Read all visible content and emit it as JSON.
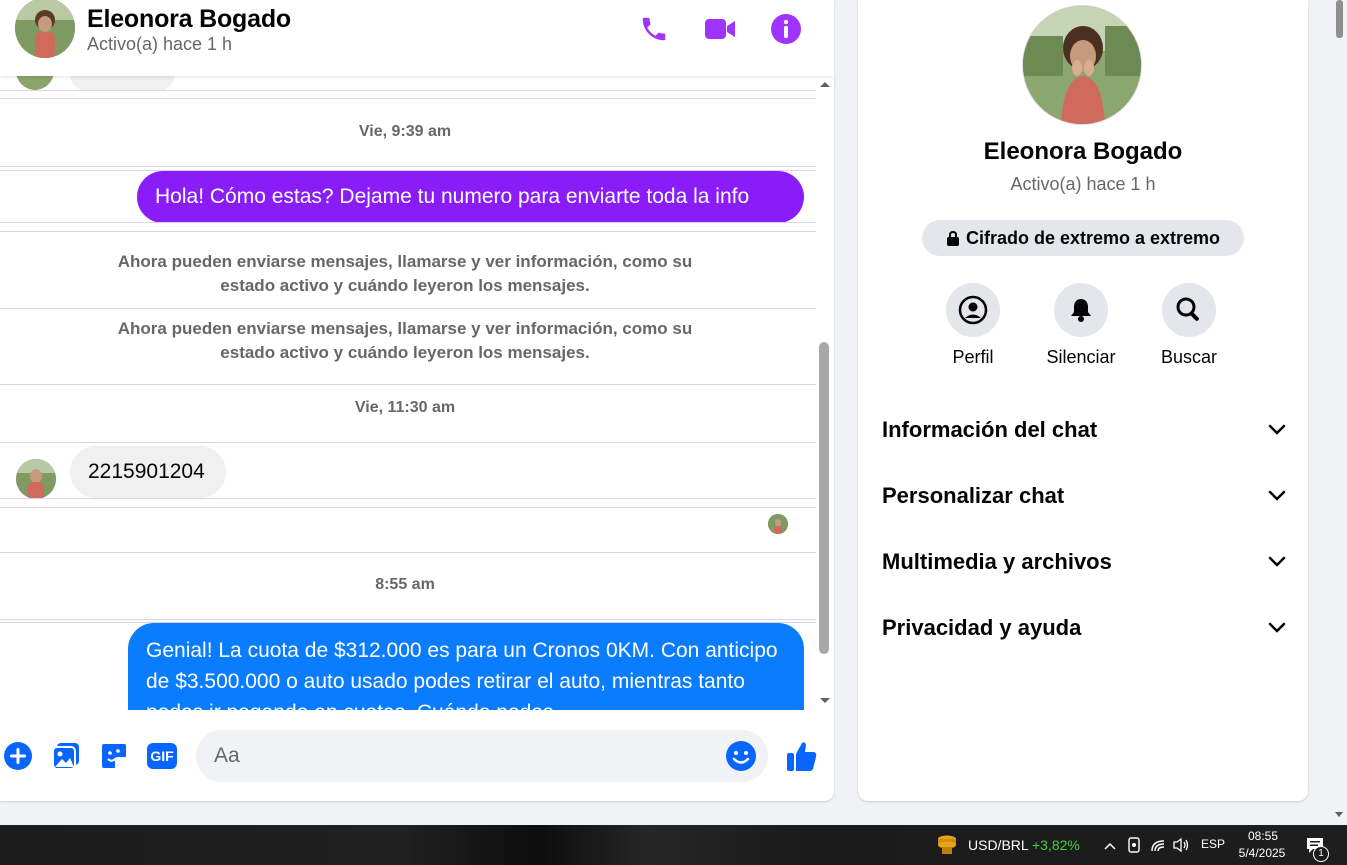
{
  "contact": {
    "name": "Eleonora Bogado",
    "status": "Activo(a) hace 1 h"
  },
  "header_icons": [
    "phone-icon",
    "video-camera-icon",
    "info-icon"
  ],
  "messages": {
    "ts1": "Vie, 9:39 am",
    "out1": "Hola! Cómo estas? Dejame tu numero para enviarte toda la info",
    "sys1": "Ahora pueden enviarse mensajes, llamarse y ver información, como su estado activo y cuándo leyeron los mensajes.",
    "sys2": "Ahora pueden enviarse mensajes, llamarse y ver información, como su estado activo y cuándo leyeron los mensajes.",
    "ts2": "Vie, 11:30 am",
    "in1": "2215901204",
    "ts3": "8:55 am",
    "out2": "Genial! La cuota de $312.000 es para un Cronos 0KM. Con anticipo de $3.500.000 o auto usado podes retirar el auto, mientras tanto podes ir pagando en cuotas. Cuándo podes"
  },
  "composer": {
    "placeholder": "Aa",
    "icons": [
      "plus-circle-icon",
      "photo-icon",
      "sticker-icon",
      "gif-icon",
      "emoji-icon",
      "thumbs-up-icon"
    ],
    "gif_label": "GIF"
  },
  "info_panel": {
    "name": "Eleonora Bogado",
    "status": "Activo(a) hace 1 h",
    "e2e": "Cifrado de extremo a extremo",
    "actions": [
      {
        "label": "Perfil",
        "icon": "profile-icon"
      },
      {
        "label": "Silenciar",
        "icon": "bell-icon"
      },
      {
        "label": "Buscar",
        "icon": "search-icon"
      }
    ],
    "sections": [
      {
        "label": "Información del chat"
      },
      {
        "label": "Personalizar chat"
      },
      {
        "label": "Multimedia y archivos"
      },
      {
        "label": "Privacidad y ayuda"
      }
    ]
  },
  "taskbar": {
    "ticker": "USD/BRL",
    "change": "+3,82%",
    "lang": "ESP",
    "time": "08:55",
    "date": "5/4/2025",
    "notifications": "1"
  },
  "colors": {
    "accent_purple": "#a033ff",
    "bubble_purple": "#8a1df7",
    "bubble_blue": "#0a7cff",
    "icon_blue": "#0866ff",
    "ticker_green": "#3fd23f"
  }
}
